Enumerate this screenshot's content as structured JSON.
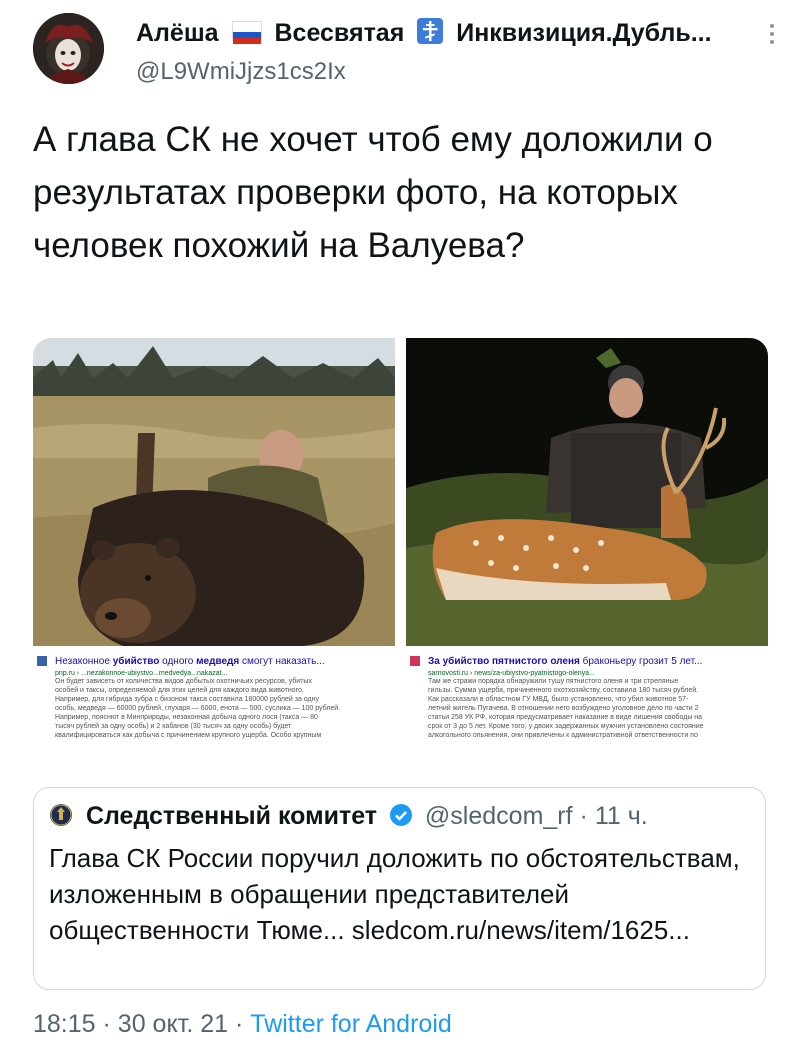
{
  "author": {
    "name_part1": "Алёша",
    "name_part2": "Всесвятая",
    "name_part3": "Инквизиция.Дубль...",
    "handle": "@L9WmiJjzs1cs2Ix"
  },
  "tweet": {
    "text": "А глава СК не хочет чтоб ему доложили о результатах проверки фото, на которых человек похожий на Валуева?"
  },
  "media": {
    "left": {
      "title_a": "Незаконное ",
      "title_b": "убийство",
      "title_c": " одного ",
      "title_d": "медведя",
      "title_e": " смогут наказать...",
      "url": "pnp.ru › ...nezakonnoe-ubiystvo...medvedya...nakazat...",
      "lines": [
        "Он будет зависеть от количества видов добытых охотничьих ресурсов, убитых",
        "особей и таксы, определяемой для этих целей для каждого вида животного.",
        "Например, для гибрида зубра с бизоном такса составила 180000 рублей за одну",
        "особь, медведя — 60000 рублей, глухаря — 6000, енота — 500, суслика — 100 рублей.",
        "Например, пояснют в Минприроды, незаконная добыча одного лося (такса — 80",
        "тысяч рублей за одну особь) и 2 кабанов (30 тысяч за одну особь) будет",
        "квалифицироваться как добыча с причинением крупного ущерба. Особо крупным"
      ]
    },
    "right": {
      "title_a": "За убийство пятнистого оленя",
      "title_b": " браконьеру грозит 5 лет...",
      "url": "sarnovosti.ru › news/za-ubiystvo-pyatnistogo-olenya...",
      "lines": [
        "Там же стражи порядка обнаружили тушу пятнистого оленя и три стреляные",
        "гильзы. Сумма ущерба, причиненного охотхозяйству, составила 180 тысяч рублей.",
        "Как рассказали в областном ГУ МВД, было установлено, что убил животное 57-",
        "летний житель Пугачева. В отношении него возбуждено уголовное дело по части 2",
        "статьи 258 УК РФ, которая предусматривает наказание в виде лишения свободы на",
        "срок от 3 до 5 лет. Кроме того, у двоих задержанных мужчин установлено состояние",
        "алкогольного опьянения, они привлечены к административной ответственности по"
      ]
    }
  },
  "quote": {
    "name": "Следственный комитет",
    "handle": "@sledcom_rf",
    "dot": "·",
    "time": "11 ч.",
    "text": "Глава СК России поручил доложить по обстоятельствам, изложенным в обращении представителей общественности Тюме... sledcom.ru/news/item/1625..."
  },
  "footer": {
    "time": "18:15",
    "sep1": "·",
    "date": "30 окт. 21",
    "sep2": "·",
    "source": "Twitter for Android"
  },
  "colors": {
    "link": "#1d9bf0",
    "secondary": "#536471",
    "text": "#0f1419",
    "border": "#cfd9de"
  }
}
